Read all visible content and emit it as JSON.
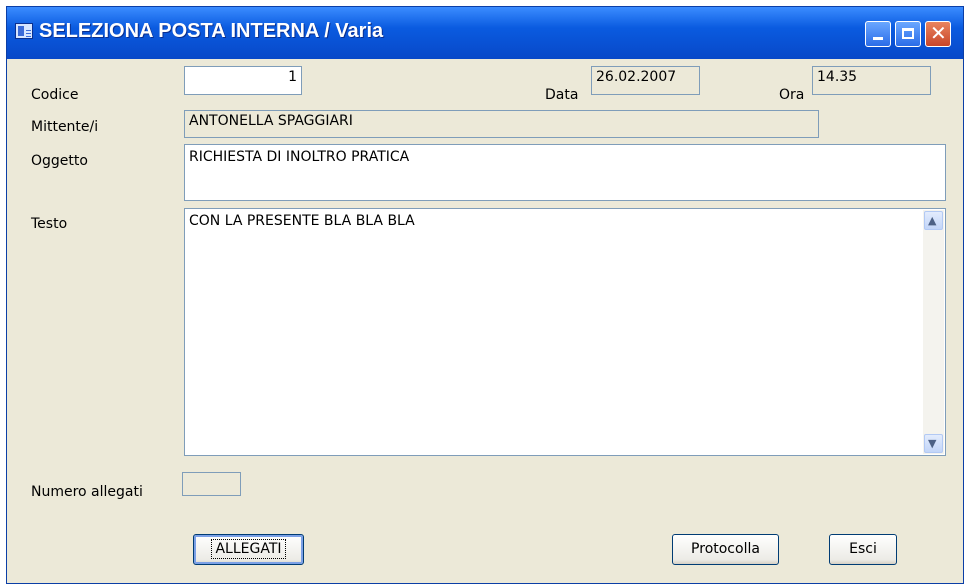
{
  "window": {
    "title": "SELEZIONA POSTA INTERNA / Varia"
  },
  "form": {
    "codice_label": "Codice",
    "codice_value": "1",
    "data_label": "Data",
    "data_value": "26.02.2007",
    "ora_label": "Ora",
    "ora_value": "14.35",
    "mittente_label": "Mittente/i",
    "mittente_value": "ANTONELLA SPAGGIARI",
    "oggetto_label": "Oggetto",
    "oggetto_value": "RICHIESTA DI INOLTRO PRATICA",
    "testo_label": "Testo",
    "testo_value": "CON LA PRESENTE BLA BLA BLA",
    "numero_allegati_label": "Numero allegati",
    "numero_allegati_value": ""
  },
  "buttons": {
    "allegati": "ALLEGATI",
    "protocolla": "Protocolla",
    "esci": "Esci"
  },
  "icons": {
    "app": "form-icon",
    "minimize": "minimize-icon",
    "maximize": "maximize-icon",
    "close": "close-icon",
    "scroll_up": "chevron-up-icon",
    "scroll_down": "chevron-down-icon"
  },
  "colors": {
    "titlebar": "#0a5be0",
    "window_bg": "#ece9d8",
    "field_border": "#7f9db9"
  }
}
